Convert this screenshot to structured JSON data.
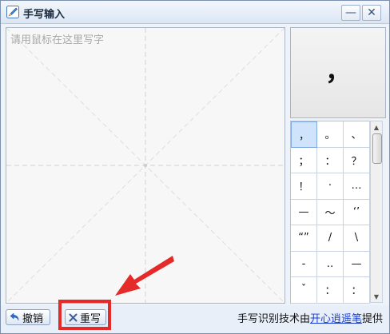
{
  "window": {
    "title": "手写输入",
    "minimize_label": "—",
    "close_label": "✕"
  },
  "canvas": {
    "placeholder": "请用鼠标在这里写字"
  },
  "preview": {
    "char": "，"
  },
  "candidates": [
    "，",
    "。",
    "、",
    "；",
    "：",
    "？",
    "！",
    "·",
    "…",
    "—",
    "～",
    "‘’",
    "“”",
    "/",
    "\\",
    "-",
    "‥",
    "—",
    "ˇ",
    "：",
    "："
  ],
  "buttons": {
    "undo": "撤销",
    "rewrite": "重写"
  },
  "credit": {
    "prefix": "手写识别技术由",
    "link": "开心逍遥笔",
    "suffix": "提供"
  },
  "colors": {
    "accent_red": "#e52a2a",
    "link_blue": "#1a3fcc",
    "selected_bg": "#cfe3fb"
  }
}
